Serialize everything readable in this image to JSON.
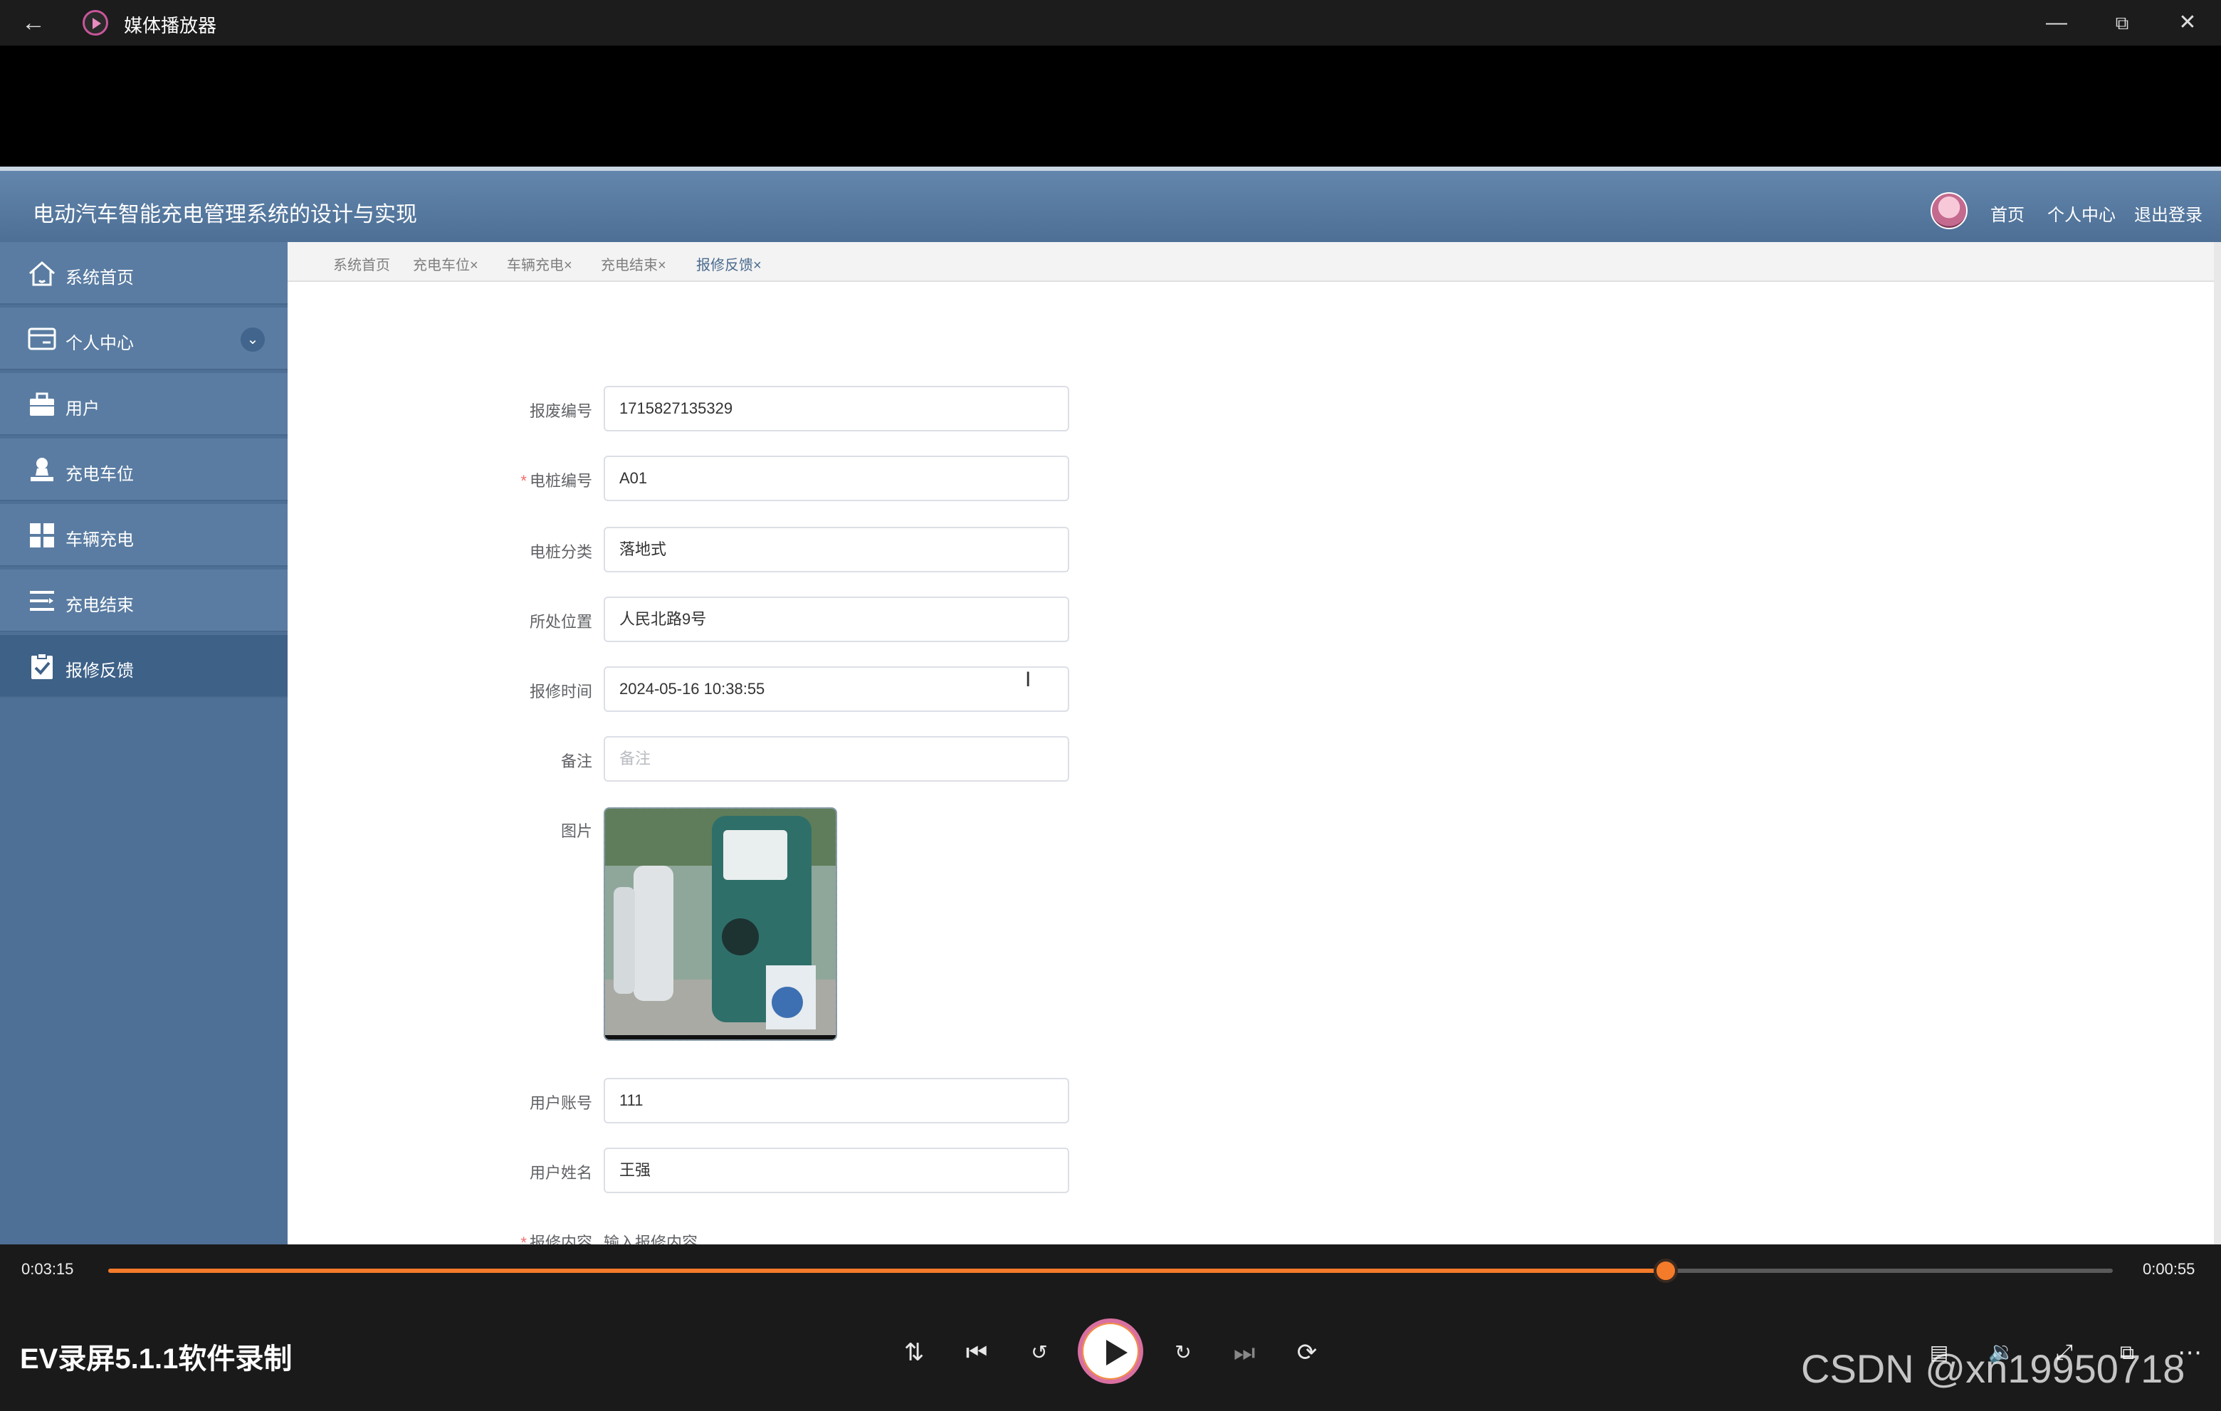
{
  "player": {
    "app_title": "媒体播放器",
    "elapsed": "0:03:15",
    "remaining": "0:00:55",
    "progress_fraction": 0.777,
    "recording_name": "EV录屏5.1.1软件录制",
    "watermark": "CSDN @xn19950718"
  },
  "app": {
    "title": "电动汽车智能充电管理系统的设计与实现",
    "nav": [
      "首页",
      "个人中心",
      "退出登录"
    ]
  },
  "sidebar": {
    "items": [
      {
        "label": "系统首页",
        "icon": "home-icon"
      },
      {
        "label": "个人中心",
        "icon": "card-icon"
      },
      {
        "label": "用户",
        "icon": "briefcase-icon"
      },
      {
        "label": "充电车位",
        "icon": "person-stamp-icon"
      },
      {
        "label": "车辆充电",
        "icon": "grid-icon"
      },
      {
        "label": "充电结束",
        "icon": "list-icon"
      },
      {
        "label": "报修反馈",
        "icon": "clipboard-check-icon"
      }
    ],
    "active": "报修反馈"
  },
  "tabs": [
    {
      "label": "系统首页"
    },
    {
      "label": "充电车位",
      "close": "×"
    },
    {
      "label": "车辆充电",
      "close": "×"
    },
    {
      "label": "充电结束",
      "close": "×"
    },
    {
      "label": "报修反馈",
      "close": "×"
    }
  ],
  "form": {
    "labels": {
      "report_no": "报废编号",
      "pile_no": "电桩编号",
      "pile_type": "电桩分类",
      "location": "所处位置",
      "report_time": "报修时间",
      "remark": "备注",
      "image": "图片",
      "user_account": "用户账号",
      "user_name": "用户姓名",
      "content": "报修内容"
    },
    "required_mark": "*",
    "values": {
      "report_no": "1715827135329",
      "pile_no": "A01",
      "pile_type": "落地式",
      "location": "人民北路9号",
      "report_time": "2024-05-16 10:38:55",
      "remark_placeholder": "备注",
      "user_account": "111",
      "user_name": "王强",
      "content_placeholder": "输入报修内容"
    }
  }
}
